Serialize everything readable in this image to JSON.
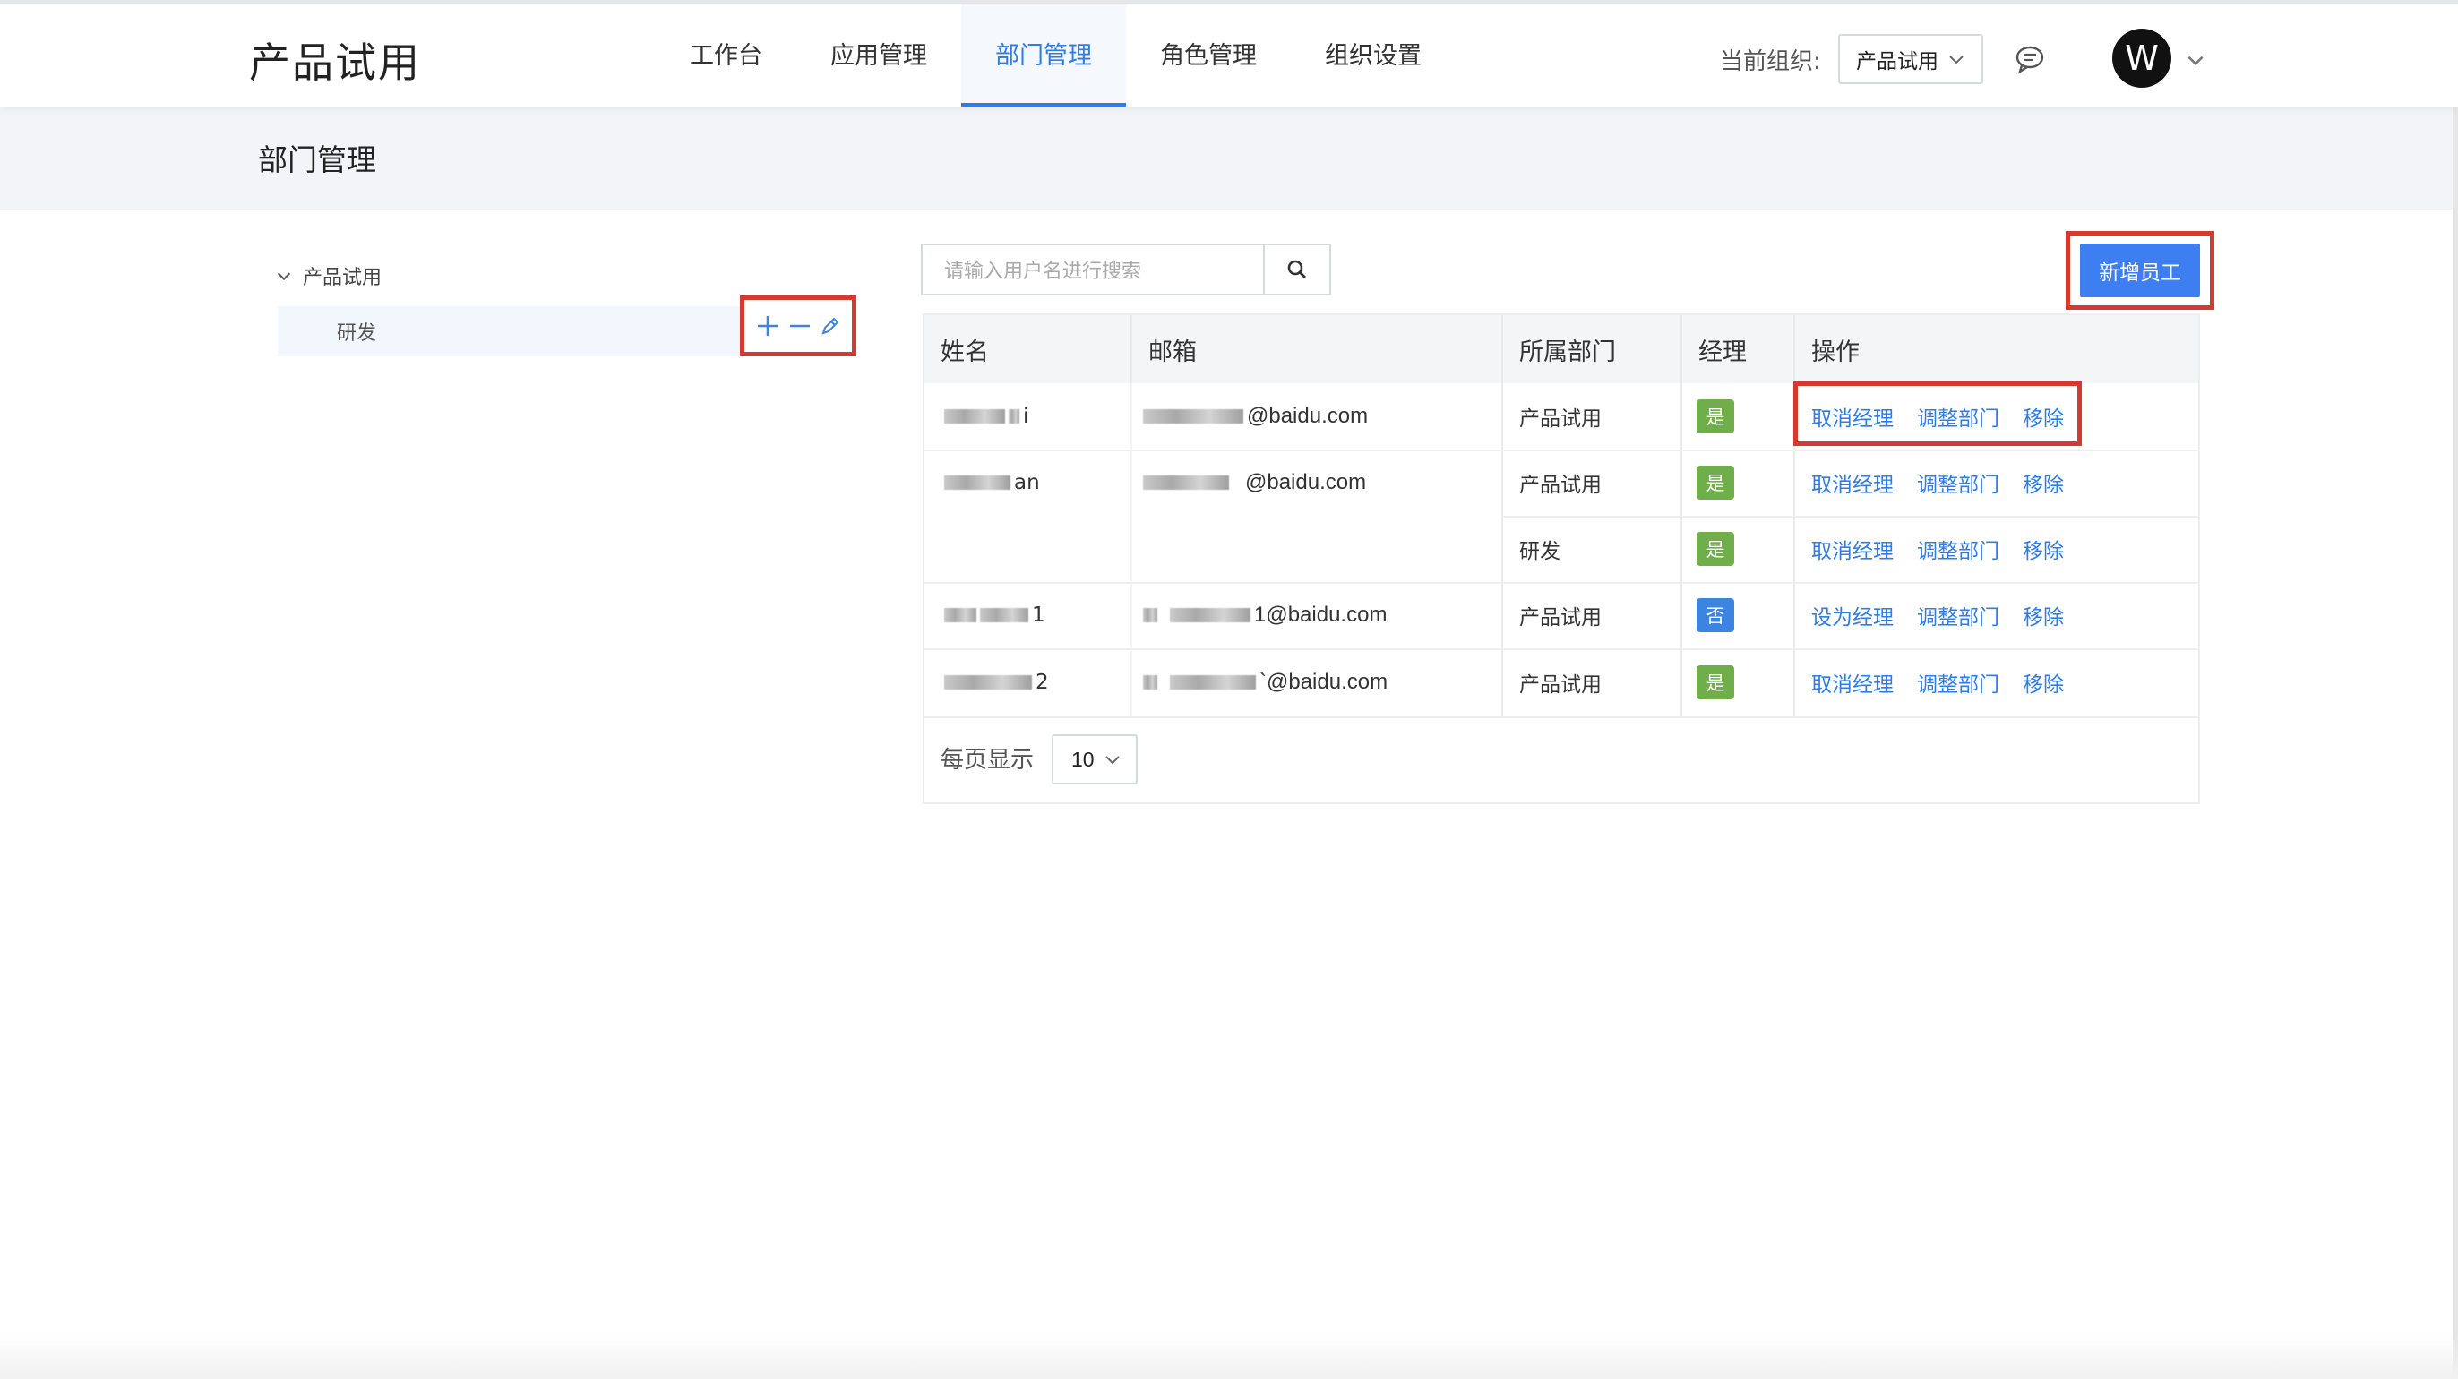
{
  "app": {
    "title": "产品试用"
  },
  "nav": [
    {
      "label": "工作台",
      "active": false
    },
    {
      "label": "应用管理",
      "active": false
    },
    {
      "label": "部门管理",
      "active": true
    },
    {
      "label": "角色管理",
      "active": false
    },
    {
      "label": "组织设置",
      "active": false
    }
  ],
  "org": {
    "label": "当前组织:",
    "selected": "产品试用"
  },
  "user": {
    "avatar_letter": "W"
  },
  "page": {
    "title": "部门管理"
  },
  "tree": {
    "root": "产品试用",
    "children": [
      "研发"
    ]
  },
  "search": {
    "placeholder": "请输入用户名进行搜索"
  },
  "actions": {
    "add_employee": "新增员工"
  },
  "table": {
    "headers": [
      "姓名",
      "邮箱",
      "所属部门",
      "经理",
      "操作"
    ],
    "rows": [
      {
        "name_suffix": "i",
        "email_suffix": "@baidu.com",
        "dept": "产品试用",
        "manager": "是",
        "ops": [
          "取消经理",
          "调整部门",
          "移除"
        ]
      },
      {
        "name_suffix": "an",
        "email_suffix": "@baidu.com",
        "dept": "产品试用",
        "manager": "是",
        "ops": [
          "取消经理",
          "调整部门",
          "移除"
        ]
      },
      {
        "name_suffix": "",
        "email_suffix": "",
        "dept": "研发",
        "manager": "是",
        "ops": [
          "取消经理",
          "调整部门",
          "移除"
        ]
      },
      {
        "name_suffix": "1",
        "email_suffix": "1@baidu.com",
        "dept": "产品试用",
        "manager": "否",
        "ops": [
          "设为经理",
          "调整部门",
          "移除"
        ]
      },
      {
        "name_suffix": "2",
        "email_suffix": "`@baidu.com",
        "dept": "产品试用",
        "manager": "是",
        "ops": [
          "取消经理",
          "调整部门",
          "移除"
        ]
      }
    ]
  },
  "pager": {
    "label": "每页显示",
    "page_size": "10"
  },
  "colors": {
    "accent": "#2e7ce8",
    "highlight": "#d23a32",
    "badge_yes": "#6fae4a",
    "badge_no": "#3d84e0"
  }
}
